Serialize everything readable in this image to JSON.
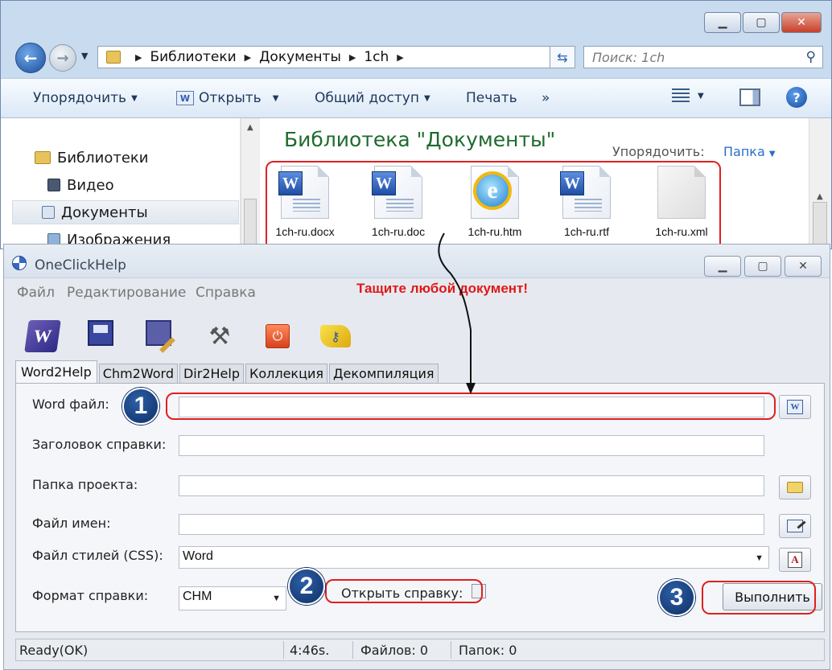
{
  "explorer": {
    "breadcrumb": [
      "Библиотеки",
      "Документы",
      "1ch"
    ],
    "search_placeholder": "Поиск: 1ch",
    "commands": {
      "organize": "Упорядочить",
      "open": "Открыть",
      "share": "Общий доступ",
      "print": "Печать",
      "more": "»"
    },
    "nav": {
      "libraries": "Библиотеки",
      "video": "Видео",
      "documents": "Документы",
      "images": "Изображения"
    },
    "library_title": "Библиотека \"Документы\"",
    "arrange_label": "Упорядочить:",
    "arrange_value": "Папка",
    "files": [
      {
        "name": "1ch-ru.docx",
        "icon": "word-doc-icon"
      },
      {
        "name": "1ch-ru.doc",
        "icon": "word-doc-icon"
      },
      {
        "name": "1ch-ru.htm",
        "icon": "ie-html-icon"
      },
      {
        "name": "1ch-ru.rtf",
        "icon": "word-doc-icon"
      },
      {
        "name": "1ch-ru.xml",
        "icon": "blank-file-icon"
      }
    ]
  },
  "app": {
    "title": "OneClickHelp",
    "menu": [
      "Файл",
      "Редактирование",
      "Справка"
    ],
    "drag_hint": "Тащите любой документ!",
    "tabs": [
      "Word2Help",
      "Chm2Word",
      "Dir2Help",
      "Коллекция",
      "Декомпиляция"
    ],
    "form": {
      "word_file_label": "Word файл:",
      "word_file_value": "",
      "help_title_label": "Заголовок справки:",
      "help_title_value": "",
      "project_folder_label": "Папка проекта:",
      "project_folder_value": "",
      "names_file_label": "Файл имен:",
      "names_file_value": "",
      "css_label": "Файл стилей (CSS):",
      "css_value": "Word",
      "format_label": "Формат справки:",
      "format_value": "CHM",
      "open_help_label": "Открыть справку:",
      "open_help_checked": false,
      "run_button": "Выполнить"
    },
    "badges": [
      "1",
      "2",
      "3"
    ],
    "status": {
      "state": "Ready(OK)",
      "time": "4:46s.",
      "files": "Файлов: 0",
      "folders": "Папок: 0"
    }
  },
  "colors": {
    "highlight_red": "#e02020",
    "badge_blue": "#1a3f80",
    "library_title_green": "#1e6b2e"
  }
}
